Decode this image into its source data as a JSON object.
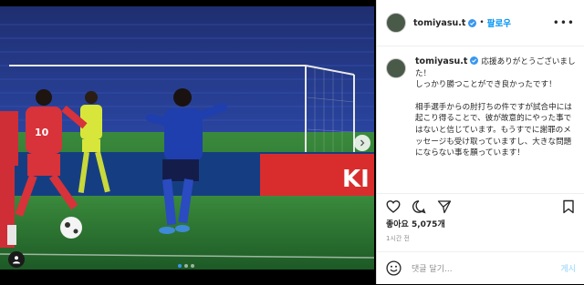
{
  "post": {
    "username": "tomiyasu.t",
    "follow_label": "팔로우",
    "separator": "•",
    "more_label": "•••",
    "caption_line1": "応援ありがとうございました！",
    "caption_line2": "しっかり勝つことができ良かったです！",
    "caption_para2": "相手選手からの肘打ちの件ですが試合中には起こり得ることで、彼が故意的にやった事ではないと信じています。もうすでに謝罪のメッセージも受け取っていますし、大きな問題にならない事を願っています！",
    "likes": "좋아요 5,075개",
    "time": "1시간 전",
    "comment_placeholder": "댓글 달기...",
    "post_button": "게시"
  },
  "photo": {
    "billboard_text": "KI",
    "image_count": 3,
    "active_index": 1
  },
  "icons": {
    "verified": "verified-badge-icon",
    "like": "heart-icon",
    "comment": "comment-icon",
    "share": "send-icon",
    "save": "bookmark-icon",
    "emoji": "emoji-icon",
    "next": "chevron-right-icon",
    "tag": "user-tag-icon"
  },
  "colors": {
    "accent": "#0095f6",
    "verified": "#3897f0",
    "japan_kit": "#1f3fae",
    "korea_kit": "#d8323a"
  }
}
